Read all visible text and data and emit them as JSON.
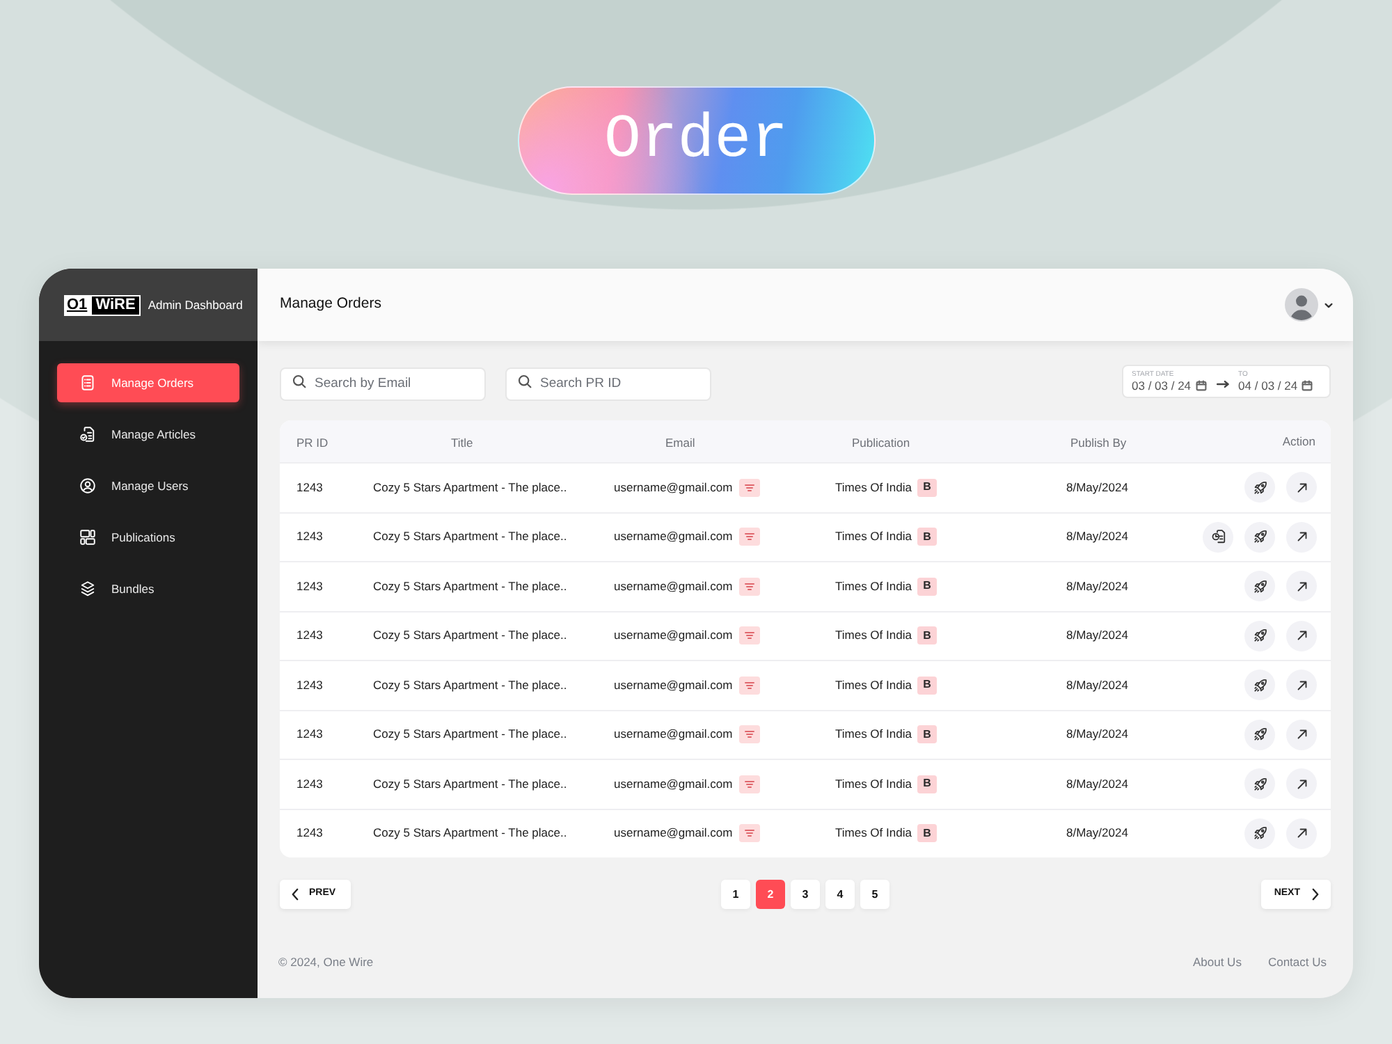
{
  "banner": {
    "title": "Order"
  },
  "sidebar": {
    "logo": {
      "mark": "O1",
      "wordmark": "WiRE"
    },
    "subtitle": "Admin Dashboard",
    "items": [
      {
        "label": "Manage Orders",
        "kind": "orders",
        "selected": true
      },
      {
        "label": "Manage Articles",
        "kind": "articles",
        "selected": false
      },
      {
        "label": "Manage Users",
        "kind": "users",
        "selected": false
      },
      {
        "label": "Publications",
        "kind": "publications",
        "selected": false
      },
      {
        "label": "Bundles",
        "kind": "bundles",
        "selected": false
      }
    ]
  },
  "header": {
    "title": "Manage Orders"
  },
  "filters": {
    "email_search": {
      "placeholder": "Search by Email"
    },
    "pr_search": {
      "placeholder": "Search PR ID"
    },
    "date_range": {
      "start_label": "START DATE",
      "start": "03 / 03 / 24",
      "end_label": "TO",
      "end": "04 / 03 / 24"
    }
  },
  "table": {
    "columns": [
      "PR ID",
      "Title",
      "Email",
      "Publication",
      "Publish By",
      "Action"
    ],
    "rows": [
      {
        "pr_id": "1243",
        "title": "Cozy 5 Stars Apartment - The place..",
        "email": "username@gmail.com",
        "publication": "Times Of India",
        "badge": "B",
        "publish_by": "8/May/2024",
        "actions": [
          {
            "kind": "publish"
          },
          {
            "kind": "open"
          }
        ]
      },
      {
        "pr_id": "1243",
        "title": "Cozy 5 Stars Apartment - The place..",
        "email": "username@gmail.com",
        "publication": "Times Of India",
        "badge": "B",
        "publish_by": "8/May/2024",
        "actions": [
          {
            "kind": "report"
          },
          {
            "kind": "publish"
          },
          {
            "kind": "open"
          }
        ]
      },
      {
        "pr_id": "1243",
        "title": "Cozy 5 Stars Apartment - The place..",
        "email": "username@gmail.com",
        "publication": "Times Of India",
        "badge": "B",
        "publish_by": "8/May/2024",
        "actions": [
          {
            "kind": "publish"
          },
          {
            "kind": "open"
          }
        ]
      },
      {
        "pr_id": "1243",
        "title": "Cozy 5 Stars Apartment - The place..",
        "email": "username@gmail.com",
        "publication": "Times Of India",
        "badge": "B",
        "publish_by": "8/May/2024",
        "actions": [
          {
            "kind": "publish"
          },
          {
            "kind": "open"
          }
        ]
      },
      {
        "pr_id": "1243",
        "title": "Cozy 5 Stars Apartment - The place..",
        "email": "username@gmail.com",
        "publication": "Times Of India",
        "badge": "B",
        "publish_by": "8/May/2024",
        "actions": [
          {
            "kind": "publish"
          },
          {
            "kind": "open"
          }
        ]
      },
      {
        "pr_id": "1243",
        "title": "Cozy 5 Stars Apartment - The place..",
        "email": "username@gmail.com",
        "publication": "Times Of India",
        "badge": "B",
        "publish_by": "8/May/2024",
        "actions": [
          {
            "kind": "publish"
          },
          {
            "kind": "open"
          }
        ]
      },
      {
        "pr_id": "1243",
        "title": "Cozy 5 Stars Apartment - The place..",
        "email": "username@gmail.com",
        "publication": "Times Of India",
        "badge": "B",
        "publish_by": "8/May/2024",
        "actions": [
          {
            "kind": "publish"
          },
          {
            "kind": "open"
          }
        ]
      },
      {
        "pr_id": "1243",
        "title": "Cozy 5 Stars Apartment - The place..",
        "email": "username@gmail.com",
        "publication": "Times Of India",
        "badge": "B",
        "publish_by": "8/May/2024",
        "actions": [
          {
            "kind": "publish"
          },
          {
            "kind": "open"
          }
        ]
      }
    ]
  },
  "pagination": {
    "prev": "PREV",
    "pages": [
      {
        "label": "1",
        "selected": false
      },
      {
        "label": "2",
        "selected": true
      },
      {
        "label": "3",
        "selected": false
      },
      {
        "label": "4",
        "selected": false
      },
      {
        "label": "5",
        "selected": false
      }
    ],
    "next": "NEXT"
  },
  "footer": {
    "copyright": "© 2024, One Wire",
    "links": [
      "About Us",
      "Contact Us"
    ]
  }
}
